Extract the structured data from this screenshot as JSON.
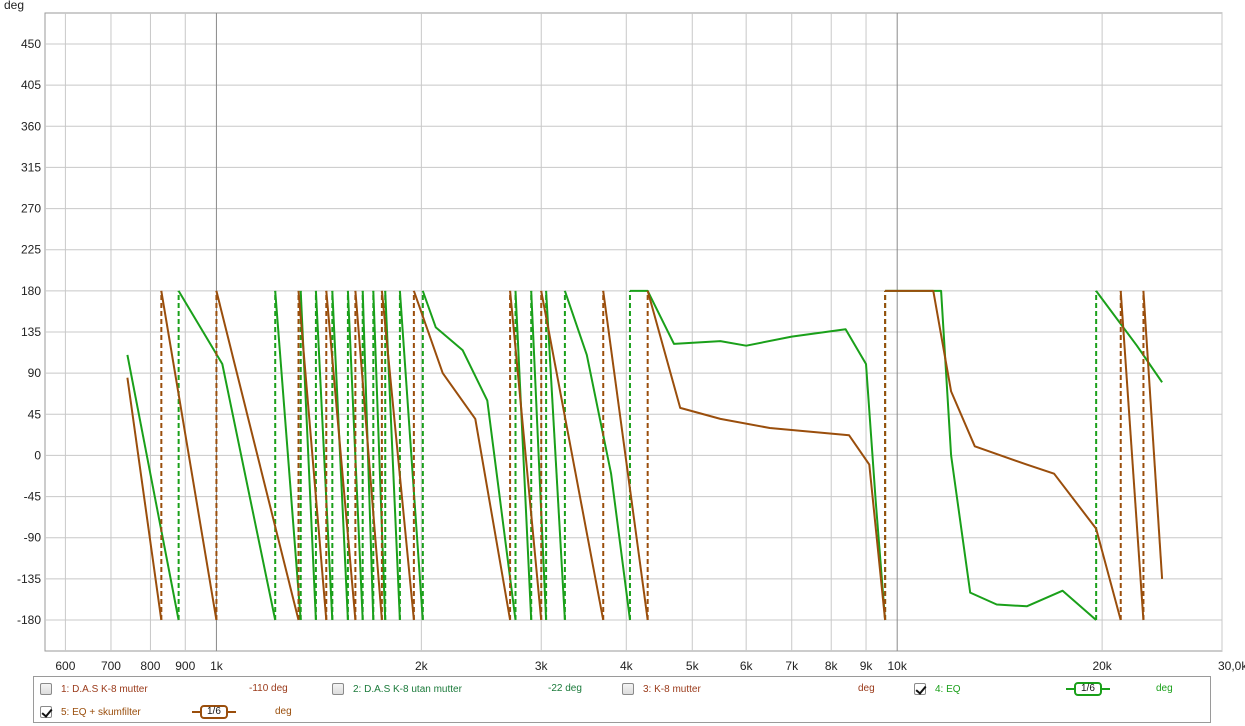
{
  "chart_data": {
    "type": "line",
    "ylabel": "deg",
    "xlabel": "",
    "ylim": [
      -180,
      450
    ],
    "y_ticks": [
      450,
      405,
      360,
      315,
      270,
      225,
      180,
      135,
      90,
      45,
      0,
      -45,
      -90,
      -135,
      -180
    ],
    "xlim": [
      560,
      30000
    ],
    "x_scale": "log",
    "x_ticks": [
      {
        "value": 600,
        "label": "600"
      },
      {
        "value": 700,
        "label": "700"
      },
      {
        "value": 800,
        "label": "800"
      },
      {
        "value": 900,
        "label": "900"
      },
      {
        "value": 1000,
        "label": "1k"
      },
      {
        "value": 2000,
        "label": "2k"
      },
      {
        "value": 3000,
        "label": "3k"
      },
      {
        "value": 4000,
        "label": "4k"
      },
      {
        "value": 5000,
        "label": "5k"
      },
      {
        "value": 6000,
        "label": "6k"
      },
      {
        "value": 7000,
        "label": "7k"
      },
      {
        "value": 8000,
        "label": "8k"
      },
      {
        "value": 9000,
        "label": "9k"
      },
      {
        "value": 10000,
        "label": "10k"
      },
      {
        "value": 20000,
        "label": "20k"
      },
      {
        "value": 30000,
        "label": "30,0kHz"
      }
    ],
    "grid": true,
    "series": [
      {
        "name": "4: EQ",
        "color": "#1aa01a",
        "wrap_points": [
          {
            "x": 740,
            "y": 110
          },
          {
            "x": 880,
            "y": -180
          },
          {
            "x": 880,
            "y": 180
          },
          {
            "x": 1020,
            "y": 100
          },
          {
            "x": 1220,
            "y": -180
          },
          {
            "x": 1220,
            "y": 180
          },
          {
            "x": 1330,
            "y": -180
          },
          {
            "x": 1330,
            "y": 180
          },
          {
            "x": 1400,
            "y": -180
          },
          {
            "x": 1400,
            "y": 180
          },
          {
            "x": 1480,
            "y": -180
          },
          {
            "x": 1480,
            "y": 180
          },
          {
            "x": 1560,
            "y": -180
          },
          {
            "x": 1560,
            "y": 180
          },
          {
            "x": 1640,
            "y": -180
          },
          {
            "x": 1640,
            "y": 180
          },
          {
            "x": 1700,
            "y": -180
          },
          {
            "x": 1700,
            "y": 180
          },
          {
            "x": 1770,
            "y": -180
          },
          {
            "x": 1770,
            "y": 180
          },
          {
            "x": 1860,
            "y": -180
          },
          {
            "x": 1860,
            "y": 180
          },
          {
            "x": 2010,
            "y": -180
          },
          {
            "x": 2010,
            "y": 180
          },
          {
            "x": 2100,
            "y": 140
          },
          {
            "x": 2300,
            "y": 115
          },
          {
            "x": 2500,
            "y": 60
          },
          {
            "x": 2750,
            "y": -180
          },
          {
            "x": 2750,
            "y": 180
          },
          {
            "x": 2900,
            "y": -180
          },
          {
            "x": 2900,
            "y": 180
          },
          {
            "x": 3050,
            "y": -180
          },
          {
            "x": 3050,
            "y": 180
          },
          {
            "x": 3250,
            "y": -180
          },
          {
            "x": 3250,
            "y": 180
          },
          {
            "x": 3500,
            "y": 110
          },
          {
            "x": 3800,
            "y": -20
          },
          {
            "x": 4050,
            "y": -180
          },
          {
            "x": 4050,
            "y": 180
          },
          {
            "x": 4300,
            "y": 180
          },
          {
            "x": 4700,
            "y": 122
          },
          {
            "x": 5500,
            "y": 125
          },
          {
            "x": 6000,
            "y": 120
          },
          {
            "x": 7000,
            "y": 130
          },
          {
            "x": 8400,
            "y": 138
          },
          {
            "x": 9000,
            "y": 100
          },
          {
            "x": 9300,
            "y": -50
          },
          {
            "x": 9600,
            "y": -180
          },
          {
            "x": 9600,
            "y": 180
          },
          {
            "x": 11600,
            "y": 180
          },
          {
            "x": 12000,
            "y": 0
          },
          {
            "x": 12800,
            "y": -150
          },
          {
            "x": 14000,
            "y": -163
          },
          {
            "x": 15500,
            "y": -165
          },
          {
            "x": 17500,
            "y": -148
          },
          {
            "x": 19600,
            "y": -180
          },
          {
            "x": 19600,
            "y": 180
          },
          {
            "x": 22500,
            "y": 120
          },
          {
            "x": 24500,
            "y": 80
          }
        ]
      },
      {
        "name": "5: EQ + skumfilter",
        "color": "#9a4e0c",
        "wrap_points": [
          {
            "x": 740,
            "y": 85
          },
          {
            "x": 830,
            "y": -180
          },
          {
            "x": 830,
            "y": 180
          },
          {
            "x": 1000,
            "y": -180
          },
          {
            "x": 1000,
            "y": 180
          },
          {
            "x": 1320,
            "y": -180
          },
          {
            "x": 1320,
            "y": 180
          },
          {
            "x": 1450,
            "y": -180
          },
          {
            "x": 1450,
            "y": 180
          },
          {
            "x": 1600,
            "y": -180
          },
          {
            "x": 1600,
            "y": 180
          },
          {
            "x": 1750,
            "y": -180
          },
          {
            "x": 1750,
            "y": 180
          },
          {
            "x": 1950,
            "y": -180
          },
          {
            "x": 1950,
            "y": 180
          },
          {
            "x": 2150,
            "y": 90
          },
          {
            "x": 2400,
            "y": 40
          },
          {
            "x": 2700,
            "y": -180
          },
          {
            "x": 2700,
            "y": 180
          },
          {
            "x": 3000,
            "y": -180
          },
          {
            "x": 3000,
            "y": 180
          },
          {
            "x": 3700,
            "y": -180
          },
          {
            "x": 3700,
            "y": 180
          },
          {
            "x": 4300,
            "y": -180
          },
          {
            "x": 4300,
            "y": 180
          },
          {
            "x": 4800,
            "y": 52
          },
          {
            "x": 5500,
            "y": 40
          },
          {
            "x": 6500,
            "y": 30
          },
          {
            "x": 8500,
            "y": 22
          },
          {
            "x": 9100,
            "y": -10
          },
          {
            "x": 9600,
            "y": -180
          },
          {
            "x": 9600,
            "y": 180
          },
          {
            "x": 11300,
            "y": 180
          },
          {
            "x": 12000,
            "y": 70
          },
          {
            "x": 13000,
            "y": 10
          },
          {
            "x": 15500,
            "y": -10
          },
          {
            "x": 17000,
            "y": -20
          },
          {
            "x": 19600,
            "y": -80
          },
          {
            "x": 21300,
            "y": -180
          },
          {
            "x": 21300,
            "y": 180
          },
          {
            "x": 23000,
            "y": -180
          },
          {
            "x": 23000,
            "y": 180
          },
          {
            "x": 24500,
            "y": -135
          }
        ]
      }
    ]
  },
  "legend": {
    "items": [
      {
        "label": "1: D.A.S K-8 mutter",
        "value": "-110 deg",
        "checked": false,
        "color": "#9a3a1a"
      },
      {
        "label": "2: D.A.S K-8 utan mutter",
        "value": "-22 deg",
        "checked": false,
        "color": "#1a7a3a"
      },
      {
        "label": "3: K-8 mutter",
        "value": "deg",
        "checked": false,
        "color": "#9a3a1a"
      },
      {
        "label": "4: EQ",
        "value": "deg",
        "checked": true,
        "color": "#1aa01a",
        "smoothing": "1/6"
      },
      {
        "label": "5: EQ + skumfilter",
        "value": "deg",
        "checked": true,
        "color": "#9a4e0c",
        "smoothing": "1/6"
      }
    ]
  }
}
